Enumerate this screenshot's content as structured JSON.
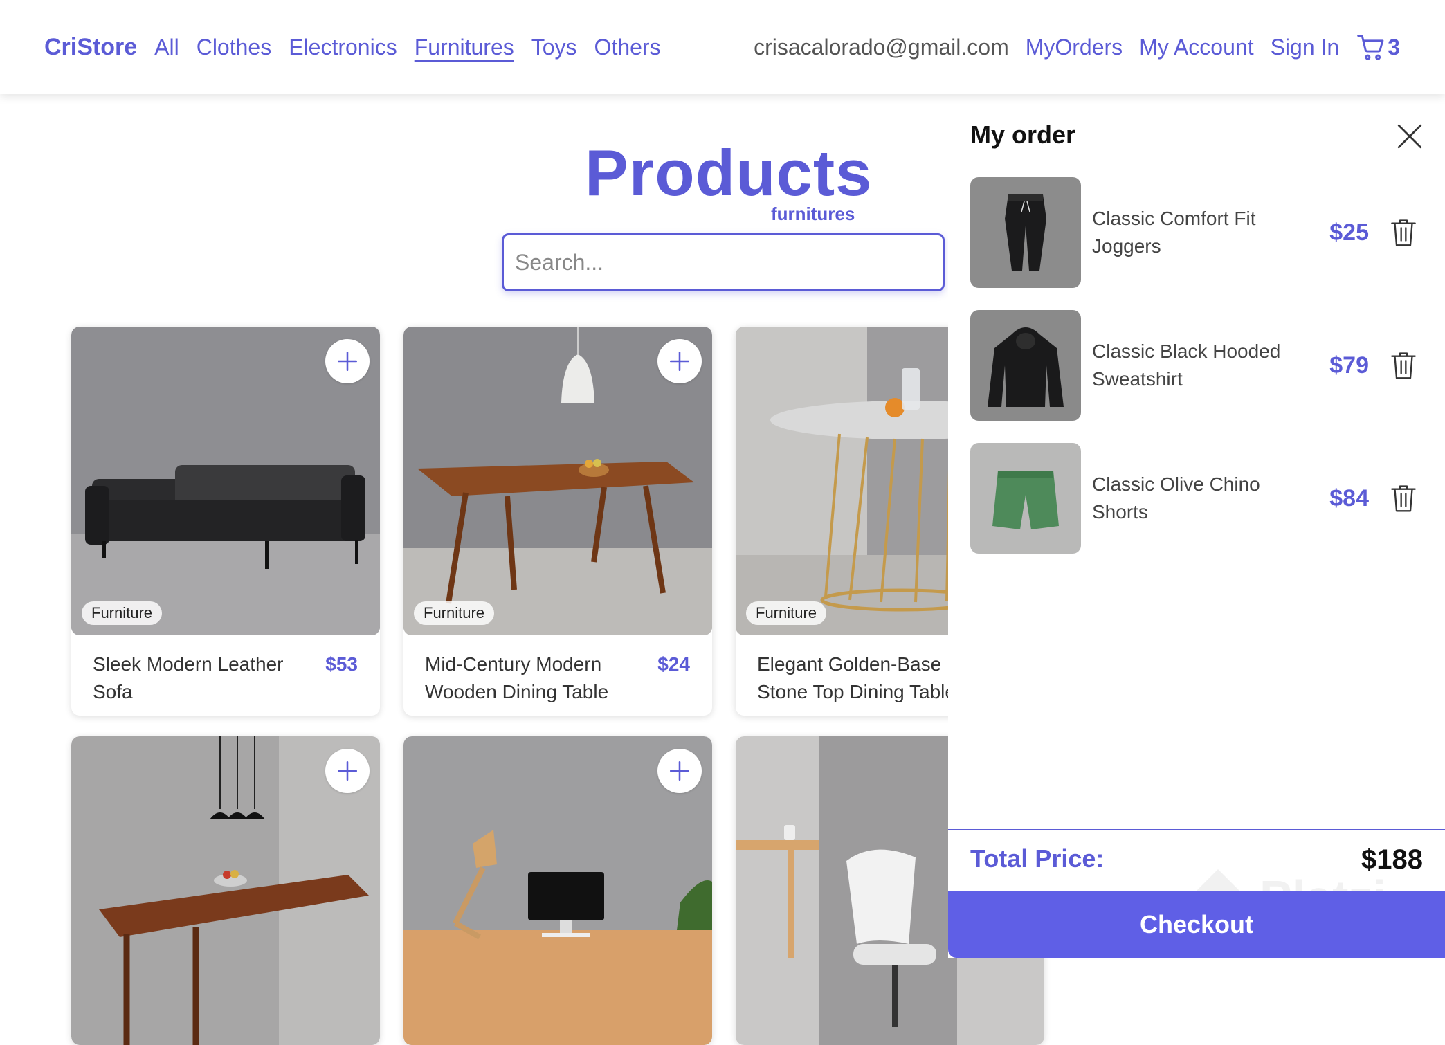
{
  "navbar": {
    "brand": "CriStore",
    "links": [
      "All",
      "Clothes",
      "Electronics",
      "Furnitures",
      "Toys",
      "Others"
    ],
    "active_link": "Furnitures",
    "email": "crisacalorado@gmail.com",
    "my_orders": "MyOrders",
    "my_account": "My Account",
    "sign_in": "Sign In",
    "cart_count": "3"
  },
  "main": {
    "title": "Products",
    "subtitle": "furnitures",
    "search_placeholder": "Search..."
  },
  "products": [
    {
      "name": "Sleek Modern Leather Sofa",
      "price": "$53",
      "category": "Furniture"
    },
    {
      "name": "Mid-Century Modern Wooden Dining Table",
      "price": "$24",
      "category": "Furniture"
    },
    {
      "name": "Elegant Golden-Base Stone Top Dining Table",
      "price": "",
      "category": "Furniture"
    }
  ],
  "order": {
    "title": "My order",
    "items": [
      {
        "name": "Classic Comfort Fit Joggers",
        "price": "$25"
      },
      {
        "name": "Classic Black Hooded Sweatshirt",
        "price": "$79"
      },
      {
        "name": "Classic Olive Chino Shorts",
        "price": "$84"
      }
    ],
    "total_label": "Total Price:",
    "total_value": "$188",
    "checkout_label": "Checkout"
  },
  "watermark": "Platzi",
  "colors": {
    "accent": "#5b5bd6",
    "checkout": "#5f5fe6"
  }
}
